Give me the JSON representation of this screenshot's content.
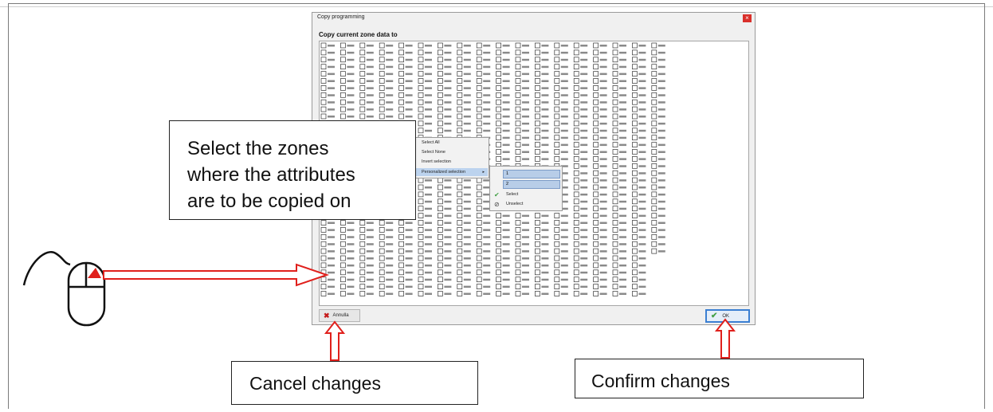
{
  "dialog": {
    "title": "Copy programming",
    "close_symbol": "×",
    "heading": "Copy current zone data to",
    "cancel_label": "Annulla",
    "ok_label": "OK"
  },
  "context_menu": {
    "items": [
      "Select All",
      "Select None",
      "Invert selection",
      "Personalized selection"
    ],
    "submenu_arrow": "▸"
  },
  "submenu": {
    "rows": [
      "1",
      "2"
    ],
    "select_label": "Select",
    "unselect_label": "Unselect"
  },
  "callouts": {
    "main_lines": [
      "Select the zones",
      "where the attributes",
      "are to be copied on"
    ],
    "cancel": "Cancel changes",
    "confirm": "Confirm changes"
  },
  "colors": {
    "arrow": "#e0201c",
    "ok_border": "#3b7fd2",
    "highlight": "#bcd3ee"
  },
  "icons": [
    "close-icon",
    "x-icon",
    "check-icon",
    "mouse-icon",
    "arrow-icon"
  ]
}
